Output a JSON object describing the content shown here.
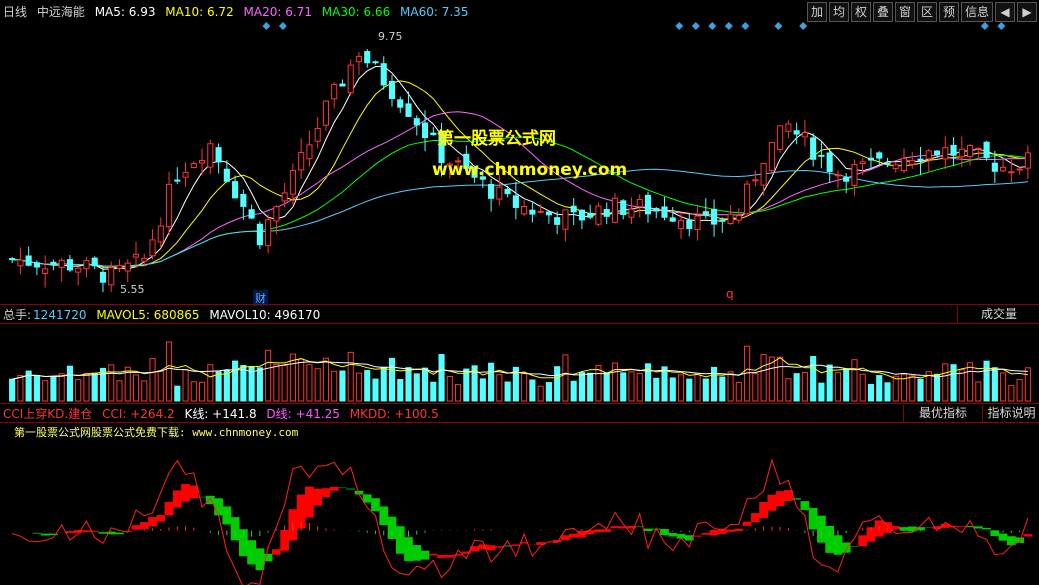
{
  "header": {
    "period": "日线",
    "stock_name": "中远海能",
    "ma": [
      {
        "label": "MA5: 6.93",
        "color": "#ffffff"
      },
      {
        "label": "MA10: 6.72",
        "color": "#ffff00"
      },
      {
        "label": "MA20: 6.71",
        "color": "#ff66ff"
      },
      {
        "label": "MA30: 6.66",
        "color": "#00ff00"
      },
      {
        "label": "MA60: 7.35",
        "color": "#55ccff"
      }
    ]
  },
  "toolbar": [
    "加",
    "均",
    "权",
    "叠",
    "窗",
    "区",
    "预",
    "信息"
  ],
  "toolbar_icons": [
    "prev-icon",
    "next-icon"
  ],
  "price_annotations": {
    "high": "9.75",
    "low": "5.55"
  },
  "event_marks": {
    "finance": "财",
    "q": "q"
  },
  "watermark": {
    "line1": "第一股票公式网",
    "line2": "www.chnmoney.com"
  },
  "volume_panel": {
    "total_label": "总手:",
    "total_value": "1241720",
    "mavol5": "MAVOL5: 680865",
    "mavol10": "MAVOL10: 496170",
    "button": "成交量"
  },
  "indicator_panel": {
    "name": "CCI上穿KD.建仓",
    "cci": "CCI: +264.2",
    "k": "K线: +141.8",
    "d": "D线: +41.25",
    "mkdd": "MKDD: +100.5",
    "button_best": "最优指标",
    "button_help": "指标说明",
    "note": "第一股票公式网股票公式免费下载: www.chnmoney.com"
  },
  "colors": {
    "up": "#ff3333",
    "down": "#54ffff",
    "ma5": "#ffffff",
    "ma10": "#ffff00",
    "ma20": "#ff66ff",
    "ma30": "#00ff00",
    "ma60": "#55ccff",
    "mark": "#3da0e0"
  },
  "chart_data": {
    "type": "candlestick",
    "y_range": [
      5.3,
      10.1
    ],
    "close_anchors": [
      [
        0,
        6.0
      ],
      [
        8,
        5.9
      ],
      [
        12,
        5.7
      ],
      [
        16,
        6.0
      ],
      [
        20,
        7.5
      ],
      [
        24,
        8.0
      ],
      [
        27,
        7.2
      ],
      [
        30,
        6.4
      ],
      [
        34,
        7.4
      ],
      [
        38,
        8.6
      ],
      [
        42,
        9.6
      ],
      [
        45,
        9.1
      ],
      [
        48,
        8.6
      ],
      [
        52,
        7.8
      ],
      [
        56,
        7.4
      ],
      [
        60,
        7.0
      ],
      [
        64,
        6.8
      ],
      [
        68,
        6.7
      ],
      [
        72,
        6.9
      ],
      [
        76,
        6.9
      ],
      [
        80,
        6.8
      ],
      [
        84,
        6.6
      ],
      [
        88,
        6.8
      ],
      [
        91,
        7.8
      ],
      [
        94,
        8.3
      ],
      [
        97,
        7.9
      ],
      [
        100,
        7.5
      ],
      [
        104,
        7.6
      ],
      [
        108,
        7.8
      ],
      [
        112,
        7.9
      ],
      [
        116,
        7.8
      ],
      [
        120,
        7.6
      ],
      [
        123,
        7.7
      ]
    ],
    "candle_count": 124,
    "volume_range": [
      0,
      1300000
    ],
    "indicator_range": [
      -150,
      300
    ]
  }
}
